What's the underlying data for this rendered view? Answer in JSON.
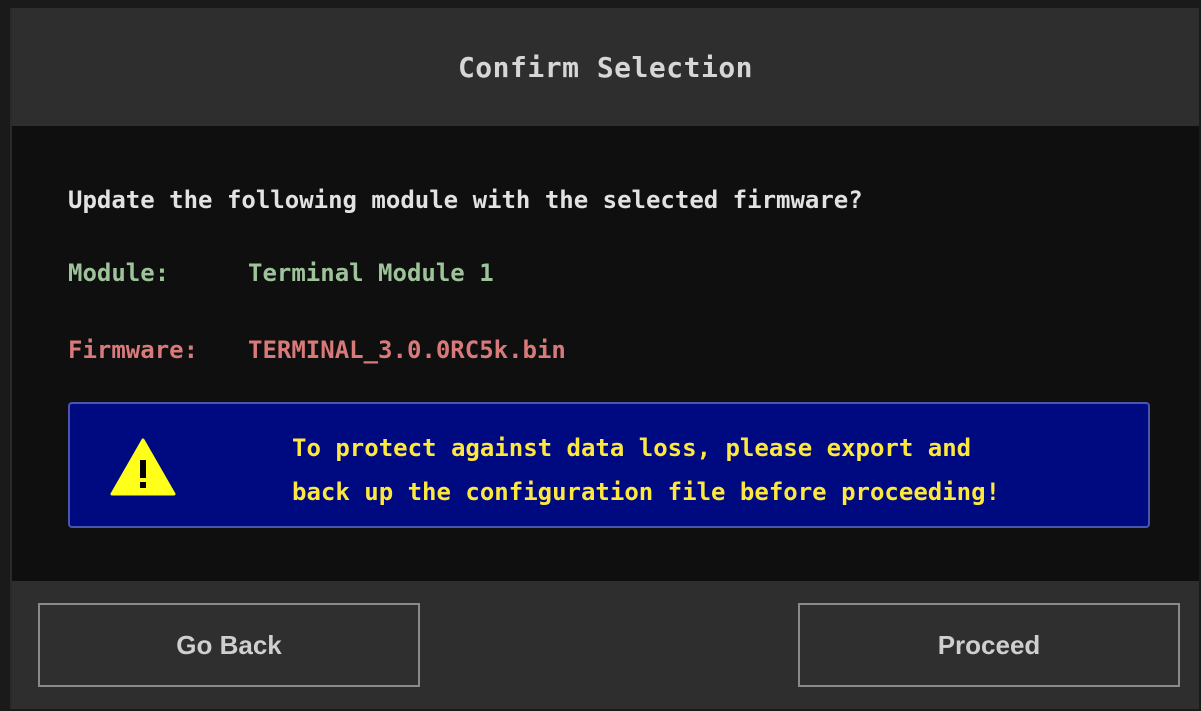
{
  "dialog": {
    "title": "Confirm Selection",
    "question": "Update the following module with the selected firmware?",
    "module": {
      "label": "Module:",
      "value": "Terminal Module 1"
    },
    "firmware": {
      "label": "Firmware:",
      "value": "TERMINAL_3.0.0RC5k.bin"
    },
    "warning": {
      "icon": "warning-triangle-icon",
      "line1": "To protect against data loss, please export and",
      "line2": "back up the configuration file before proceeding!"
    },
    "buttons": {
      "back_label": "Go Back",
      "proceed_label": "Proceed"
    }
  },
  "colors": {
    "titlebar": "#2e2e2e",
    "body": "#0f0f0f",
    "module_text": "#9ec39a",
    "firmware_text": "#d97a7a",
    "warning_bg": "#000a80",
    "warning_text": "#ffe83d"
  }
}
